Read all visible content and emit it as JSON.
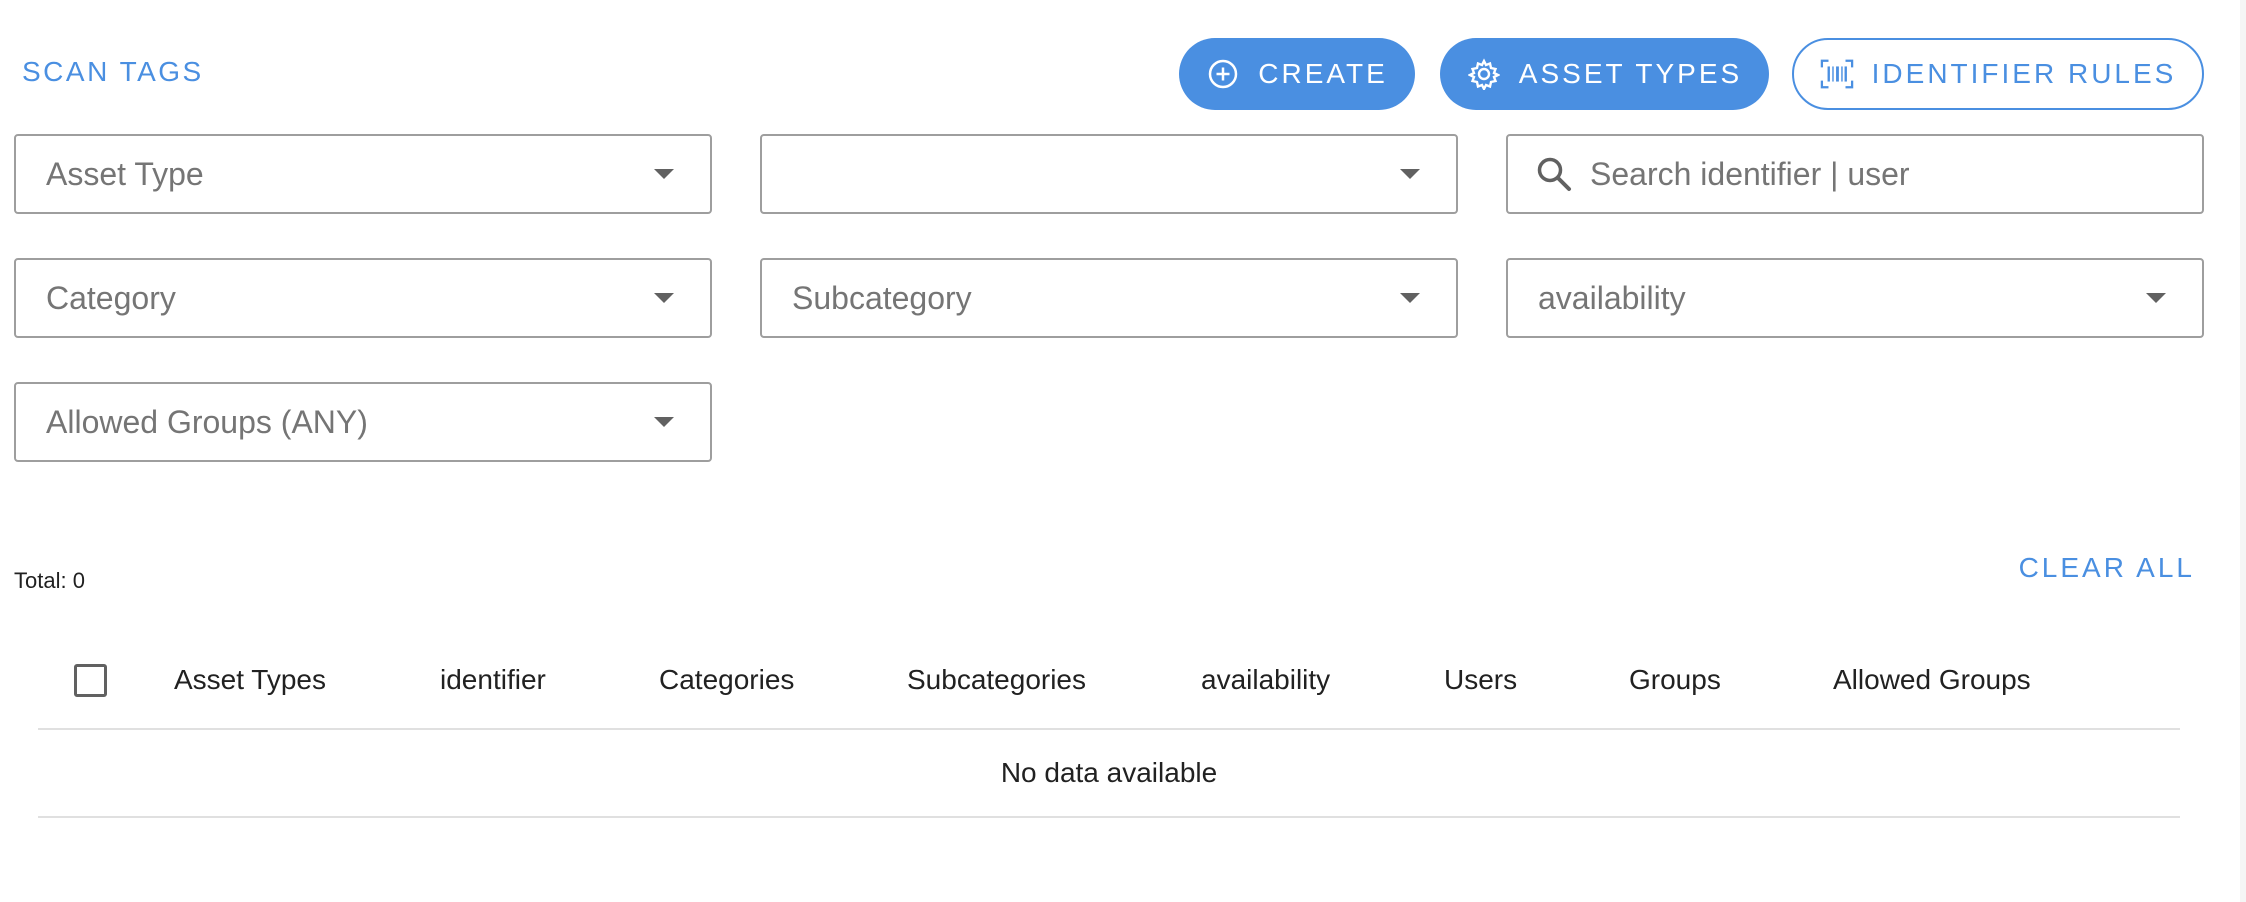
{
  "header": {
    "scan_tags_label": "SCAN TAGS",
    "create_label": "CREATE",
    "asset_types_label": "ASSET TYPES",
    "identifier_rules_label": "IDENTIFIER RULES"
  },
  "filters": {
    "asset_type": "Asset Type",
    "unnamed_select": "",
    "search_placeholder": "Search identifier | user",
    "category": "Category",
    "subcategory": "Subcategory",
    "availability": "availability",
    "allowed_groups": "Allowed Groups (ANY)"
  },
  "summary": {
    "total": "Total: 0",
    "clear_all": "CLEAR ALL"
  },
  "table": {
    "columns": [
      "Asset Types",
      "identifier",
      "Categories",
      "Subcategories",
      "availability",
      "Users",
      "Groups",
      "Allowed Groups"
    ],
    "empty_text": "No data available"
  },
  "colors": {
    "accent": "#4a8fe1",
    "border": "#9e9e9e",
    "divider": "#e0e0e0"
  }
}
